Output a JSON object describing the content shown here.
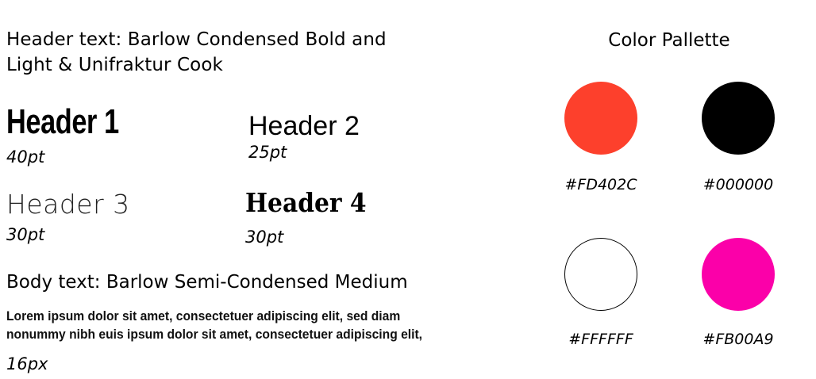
{
  "intro": {
    "line1": "Header text: Barlow Condensed Bold and",
    "line2": "Light & Unifraktur Cook"
  },
  "headers": [
    {
      "label": "Header 1",
      "size": "40pt"
    },
    {
      "label": "Header 2",
      "size": "25pt"
    },
    {
      "label": "Header 3",
      "size": "30pt"
    },
    {
      "label": "Header 4",
      "size": "30pt"
    }
  ],
  "body": {
    "title": "Body text: Barlow Semi-Condensed Medium",
    "sample_line1": "Lorem ipsum dolor sit amet, consectetuer adipiscing elit, sed diam",
    "sample_line2": "nonummy nibh euis ipsum dolor sit amet, consectetuer adipiscing elit,",
    "size": "16px"
  },
  "palette": {
    "title": "Color Pallette",
    "colors": [
      {
        "hex": "#FD402C",
        "label": "#FD402C"
      },
      {
        "hex": "#000000",
        "label": "#000000"
      },
      {
        "hex": "#FFFFFF",
        "label": "#FFFFFF"
      },
      {
        "hex": "#FB00A9",
        "label": "#FB00A9"
      }
    ]
  }
}
